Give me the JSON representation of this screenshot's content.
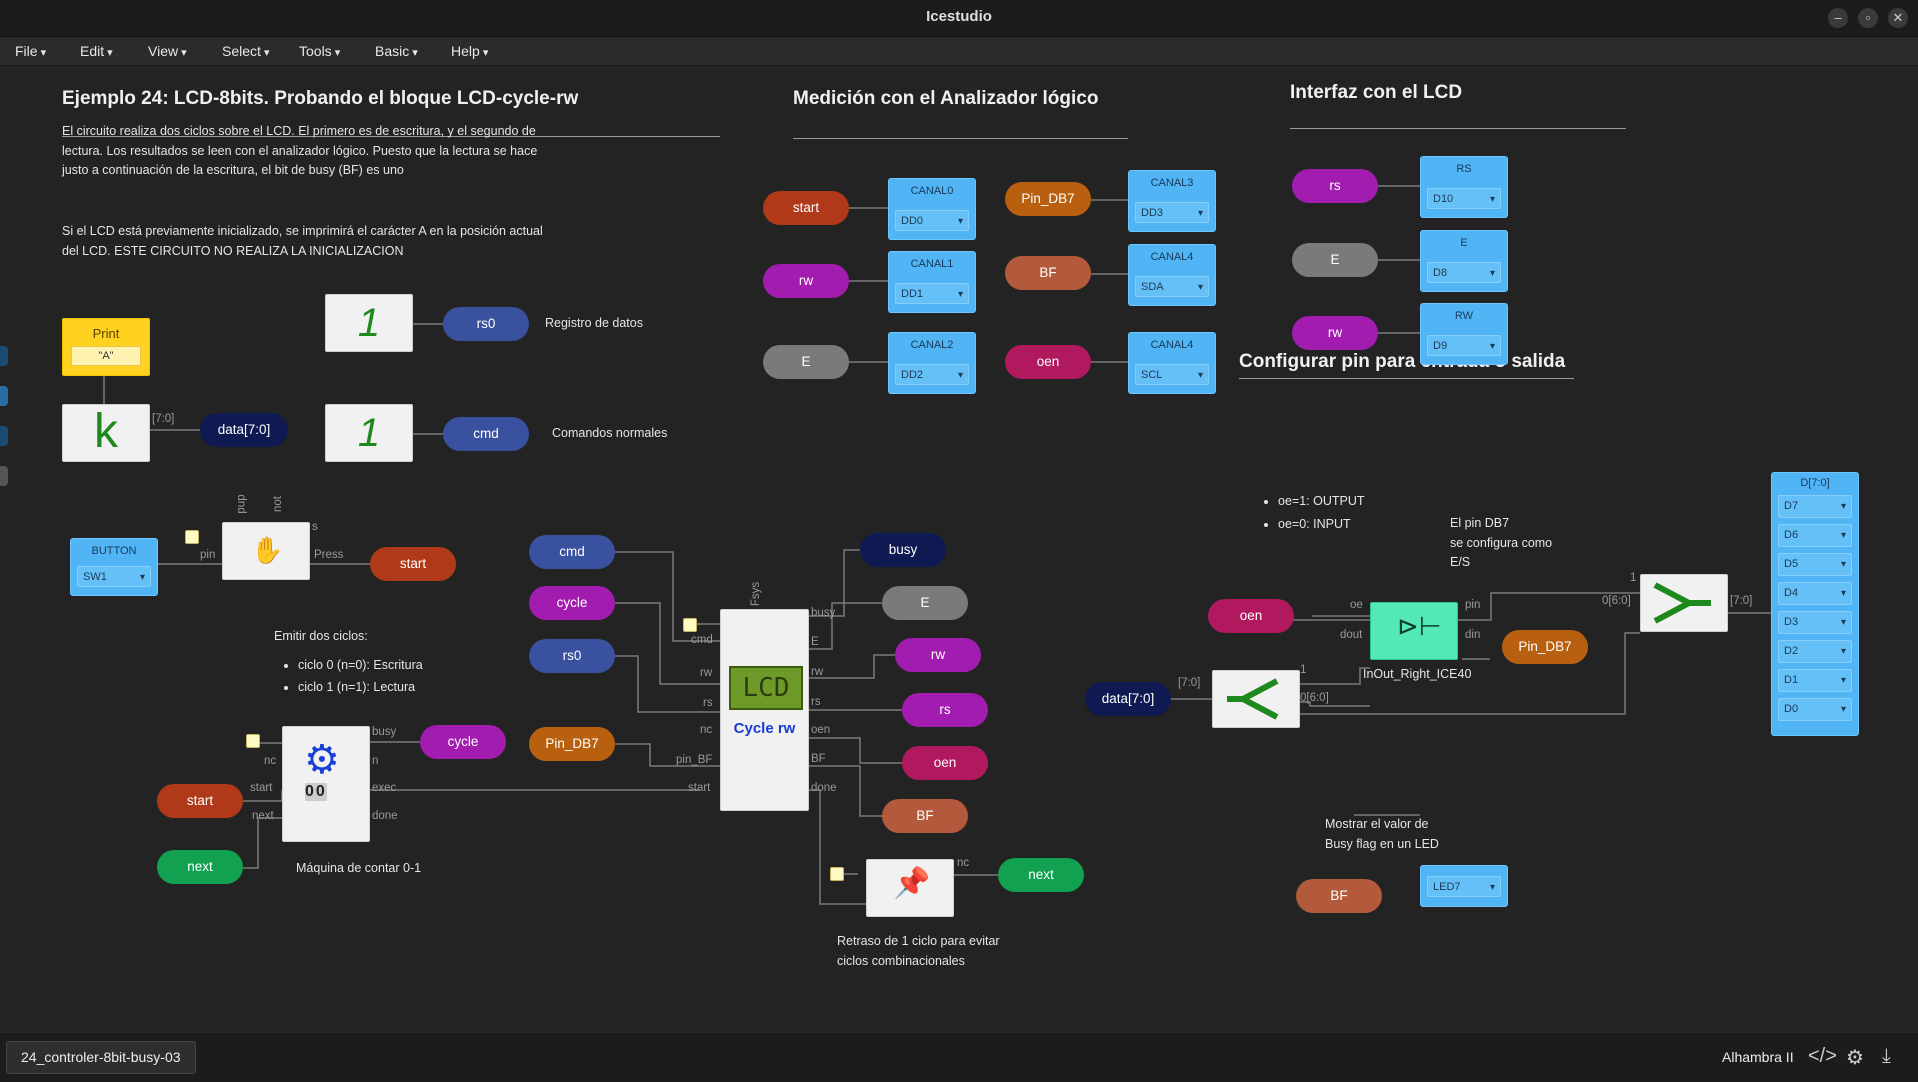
{
  "window": {
    "title": "Icestudio"
  },
  "menu": [
    "File",
    "Edit",
    "View",
    "Select",
    "Tools",
    "Basic",
    "Help"
  ],
  "sections": {
    "main_title": "Ejemplo 24: LCD-8bits. Probando el bloque LCD-cycle-rw",
    "main_desc1": "El circuito realiza dos ciclos sobre el LCD. El primero es de escritura, y el segundo de",
    "main_desc2": "lectura. Los resultados se leen con el analizador lógico. Puesto que la lectura se hace",
    "main_desc3": "justo a continuación de la escritura, el bit de busy (BF) es uno",
    "main_desc4": "Si el LCD está previamente inicializado, se imprimirá el carácter A en la posición actual",
    "main_desc5": "del LCD. ESTE CIRCUITO NO REALIZA LA INICIALIZACION",
    "analyzer_title": "Medición con el Analizador lógico",
    "lcd_title": "Interfaz con el LCD",
    "pin_title": "Configurar pin para entrada o salida"
  },
  "notes": {
    "reg_datos": "Registro de datos",
    "cmd_normales": "Comandos normales",
    "emitir": "Emitir dos ciclos:",
    "ciclo0": "ciclo 0 (n=0): Escritura",
    "ciclo1": "ciclo 1 (n=1): Lectura",
    "maquina": "Máquina de contar 0-1",
    "retraso1": "Retraso de 1 ciclo para evitar",
    "retraso2": "ciclos combinacionales",
    "oe1": "oe=1: OUTPUT",
    "oe0": "oe=0: INPUT",
    "db7_1": "El pin DB7",
    "db7_2": "se configura como",
    "db7_3": "E/S",
    "busy1": "Mostrar el valor de",
    "busy2": "Busy flag en un LED",
    "inout_name": "InOut_Right_ICE40"
  },
  "print_block": {
    "title": "Print",
    "value": "\"A\""
  },
  "k_block": {
    "glyph": "k",
    "bus": "[7:0]"
  },
  "const_glyph": "1",
  "lcd_block": {
    "screen": "LCD",
    "name": "Cycle rw",
    "fsys": "Fsys"
  },
  "io_blocks": {
    "button": {
      "label": "BUTTON",
      "value": "SW1"
    },
    "canal0": {
      "label": "CANAL0",
      "value": "DD0"
    },
    "canal1": {
      "label": "CANAL1",
      "value": "DD1"
    },
    "canal2": {
      "label": "CANAL2",
      "value": "DD2"
    },
    "canal3": {
      "label": "CANAL3",
      "value": "DD3"
    },
    "canal4a": {
      "label": "CANAL4",
      "value": "SDA"
    },
    "canal4b": {
      "label": "CANAL4",
      "value": "SCL"
    },
    "rs": {
      "label": "RS",
      "value": "D10"
    },
    "e": {
      "label": "E",
      "value": "D8"
    },
    "rw": {
      "label": "RW",
      "value": "D9"
    },
    "led": {
      "value": "LED7"
    },
    "bus": {
      "label": "D[7:0]",
      "items": [
        "D7",
        "D6",
        "D5",
        "D4",
        "D3",
        "D2",
        "D1",
        "D0"
      ]
    }
  },
  "labels": {
    "data70": "data[7:0]",
    "rs0": "rs0",
    "cmd": "cmd",
    "start": "start",
    "cycle": "cycle",
    "next": "next",
    "busy": "busy",
    "E": "E",
    "rw": "rw",
    "rs": "rs",
    "oen": "oen",
    "BF": "BF",
    "Pin_DB7": "Pin_DB7"
  },
  "ports": {
    "pup": "pup",
    "not": "not",
    "s": "s",
    "pin": "pin",
    "press": "Press",
    "nc": "nc",
    "start": "start",
    "next": "next",
    "busy": "busy",
    "n": "n",
    "exec": "exec",
    "done": "done",
    "cmd": "cmd",
    "rw": "rw",
    "rs": "rs",
    "pin_bf": "pin_BF",
    "E": "E",
    "oen": "oen",
    "BF": "BF",
    "oe": "oe",
    "dout": "dout",
    "din": "din",
    "bus70": "[7:0]",
    "one": "1",
    "z60": "0[6:0]",
    "z60b": "0[6:0]",
    "bus70b": "[7:0]",
    "one_b": "1",
    "bus70c": "[7:0]"
  },
  "colors": {
    "red": "#b0391a",
    "purple": "#a21caf",
    "blue": "#3a51a0",
    "navy": "#0f1a52",
    "gray": "#7a7a7a",
    "orange": "#b8600f",
    "brick": "#b45a3c",
    "green": "#12a150",
    "crimson": "#b0195e"
  },
  "status": {
    "file": "24_controler-8bit-busy-03",
    "board": "Alhambra II"
  }
}
